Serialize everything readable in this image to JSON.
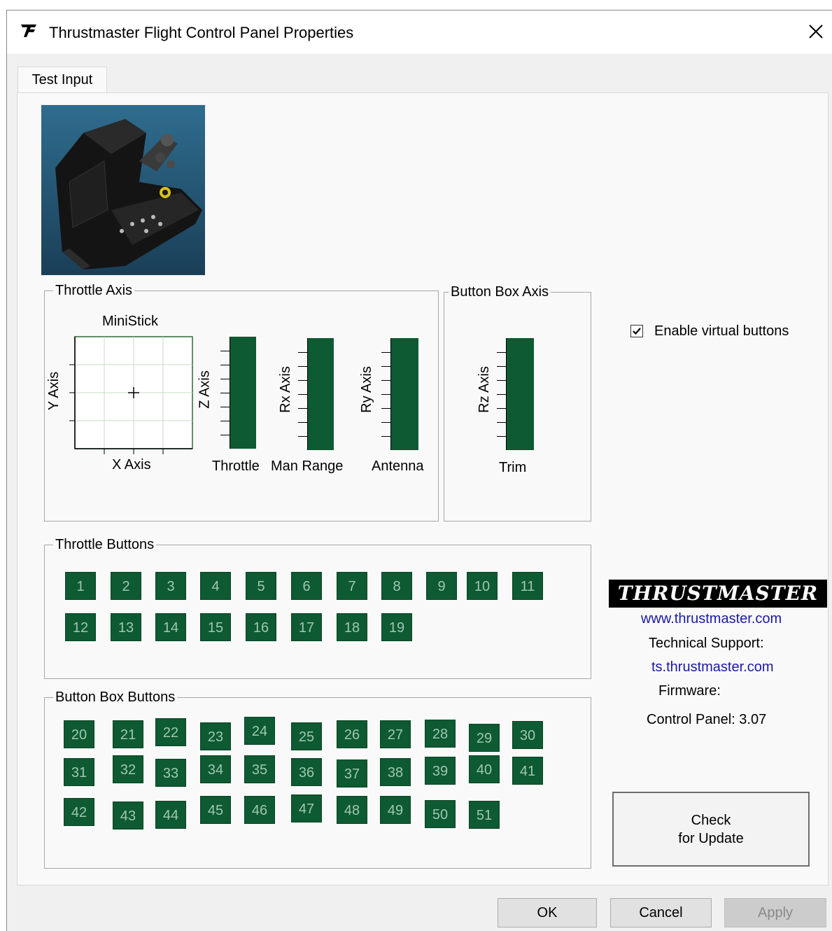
{
  "window": {
    "title": "Thrustmaster Flight Control Panel Properties",
    "close_glyph": "✕"
  },
  "tabs": [
    {
      "label": "Test Input",
      "selected": true
    }
  ],
  "throttle_axis": {
    "label": "Throttle Axis",
    "ministick_label": "MiniStick",
    "x_axis_label": "X Axis",
    "y_axis_label": "Y Axis",
    "bars": [
      {
        "axis_label": "Z Axis",
        "caption": "Throttle",
        "level": 1.0
      },
      {
        "axis_label": "Rx Axis",
        "caption": "Man Range",
        "level": 1.0
      },
      {
        "axis_label": "Ry Axis",
        "caption": "Antenna",
        "level": 1.0
      }
    ]
  },
  "button_box_axis": {
    "label": "Button Box Axis",
    "bar": {
      "axis_label": "Rz Axis",
      "caption": "Trim",
      "level": 1.0
    }
  },
  "virtual_buttons": {
    "label": "Enable virtual buttons",
    "checked": true
  },
  "throttle_buttons": {
    "label": "Throttle Buttons",
    "buttons": [
      "1",
      "2",
      "3",
      "4",
      "5",
      "6",
      "7",
      "8",
      "9",
      "10",
      "11",
      "12",
      "13",
      "14",
      "15",
      "16",
      "17",
      "18",
      "19"
    ]
  },
  "button_box_buttons": {
    "label": "Button Box Buttons",
    "buttons": [
      "20",
      "21",
      "22",
      "23",
      "24",
      "25",
      "26",
      "27",
      "28",
      "29",
      "30",
      "31",
      "32",
      "33",
      "34",
      "35",
      "36",
      "37",
      "38",
      "39",
      "40",
      "41",
      "42",
      "43",
      "44",
      "45",
      "46",
      "47",
      "48",
      "49",
      "50",
      "51"
    ]
  },
  "brand": {
    "logo_text": "THRUSTMASTER",
    "website": "www.thrustmaster.com",
    "support_label": "Technical Support:",
    "support_link": "ts.thrustmaster.com",
    "firmware_label": "Firmware:",
    "control_panel_version": "Control Panel: 3.07"
  },
  "check_update": {
    "line1": "Check",
    "line2": "for Update"
  },
  "dialog_buttons": {
    "ok": "OK",
    "cancel": "Cancel",
    "apply": "Apply",
    "apply_enabled": false
  },
  "colors": {
    "indicator_green": "#0e5a32",
    "link_blue": "#1a1aa6"
  }
}
